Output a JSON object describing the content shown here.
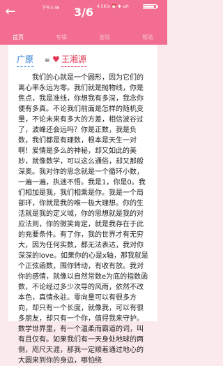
{
  "status_bar": {
    "time": "下午3:46",
    "network": "4.5K/s ⏰ ✱ ₄₆ⅈ",
    "battery_level": 0.85
  },
  "header": {
    "back_icon": "arrow-left-icon",
    "page_indicator": "3/6"
  },
  "tabs": [
    {
      "label": "首页",
      "active": true
    },
    {
      "label": "专辑",
      "active": false
    },
    {
      "label": "发现",
      "active": false
    },
    {
      "label": "帮助",
      "active": false
    }
  ],
  "letter": {
    "name_a": "广原",
    "eq_symbol": "≡",
    "heart_icon": "heart-icon",
    "name_b": "王湘源",
    "text": "我们的心就是一个圆形，因为它们的离心率永远为零。我们就是抛物线，你是焦点，我是准线，你想我有多深，我念你便有多真。不论我们前面是怎样的随机变量，不论未来有多大的方差，相信波谷过了，波峰还会远吗？你是正数，我是负数，我们都是有理数，根本是天生一对啊！爱情是多么的神秘，却又如此的美妙，就像数学，可以这么通俗，却又那般深奥。我对你的思念就是一个循环小数，一遍一遍，执迷不悟。我是1，你是0。我们相加是我，我们相乘是你。我是一个局部环，你就是我的唯一极大理想。你的生活就是我的定义域，你的思想就是我的对应法则，你的微笑肯定，就是我存在于此的充要条件。有了你，我的世界才有无穷大，因为任何实数，都无法表达，我对你深深的love。如果你的心是x轴，那我就是个正弦函数，围你转动，有收有放。我对你的感情，就像以自然常数e为底的指数函数，不论经过多少次导的风雨，依然不改本色，真情永驻。零向量可以有很多方向，却只有一个长度，就像我，可以有很多朋友，却只有一个你，值得我来守护。数学世界里，有一个温柔而霸道的词，叫有且仅有。如果我们有一天身处地球的两侧，咫尺天涯，那我一定顺着通过地心的大圆来到你的身边，哪怕绕"
  }
}
